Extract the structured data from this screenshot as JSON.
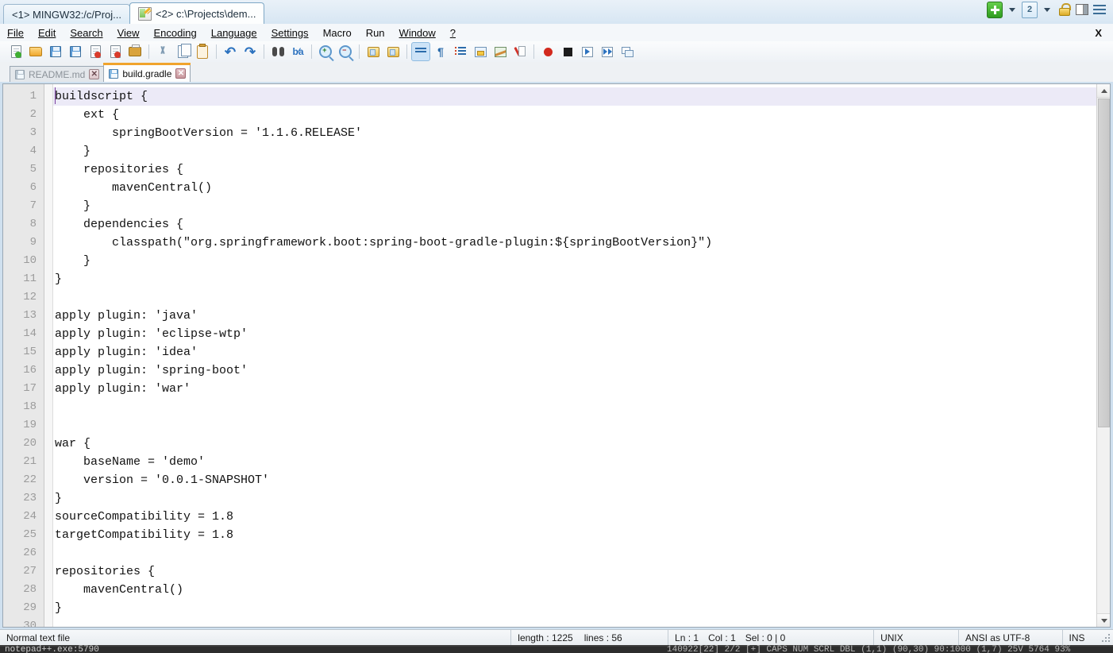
{
  "window": {
    "tabs": [
      {
        "label": "<1> MINGW32:/c/Proj...",
        "active": false,
        "icon": "terminal-icon"
      },
      {
        "label": "<2> c:\\Projects\\dem...",
        "active": true,
        "icon": "notepad-icon"
      }
    ],
    "controls": {
      "new_tab": "+",
      "new_tab_caret": "▾",
      "console_count": "2",
      "console_caret": "▾",
      "lock": "lock-icon",
      "panel": "panel-icon",
      "menu": "hamburger-icon"
    }
  },
  "menubar": {
    "items": [
      "File",
      "Edit",
      "Search",
      "View",
      "Encoding",
      "Language",
      "Settings",
      "Macro",
      "Run",
      "Window",
      "?"
    ],
    "close_label": "X"
  },
  "toolbar": {
    "buttons": [
      {
        "name": "new-file",
        "title": "New"
      },
      {
        "name": "open-file",
        "title": "Open"
      },
      {
        "name": "save-file",
        "title": "Save"
      },
      {
        "name": "save-all",
        "title": "Save All"
      },
      {
        "name": "close-file",
        "title": "Close"
      },
      {
        "name": "close-all",
        "title": "Close All"
      },
      {
        "name": "print",
        "title": "Print"
      },
      {
        "name": "cut",
        "title": "Cut"
      },
      {
        "name": "copy",
        "title": "Copy"
      },
      {
        "name": "paste",
        "title": "Paste"
      },
      {
        "name": "undo",
        "title": "Undo"
      },
      {
        "name": "redo",
        "title": "Redo"
      },
      {
        "name": "find",
        "title": "Find"
      },
      {
        "name": "replace",
        "title": "Replace"
      },
      {
        "name": "zoom-in",
        "title": "Zoom In"
      },
      {
        "name": "zoom-out",
        "title": "Zoom Out"
      },
      {
        "name": "sync-v-scroll",
        "title": "Synchronize Vertical Scrolling"
      },
      {
        "name": "sync-h-scroll",
        "title": "Synchronize Horizontal Scrolling"
      },
      {
        "name": "word-wrap",
        "title": "Word Wrap",
        "active": true
      },
      {
        "name": "show-all-chars",
        "title": "Show All Characters"
      },
      {
        "name": "show-indent-guide",
        "title": "Show Indent Guide"
      },
      {
        "name": "user-define-dialog",
        "title": "User Defined Dialogue"
      },
      {
        "name": "doc-map",
        "title": "Document Map"
      },
      {
        "name": "function-list",
        "title": "Function List"
      },
      {
        "name": "record-macro",
        "title": "Start Recording"
      },
      {
        "name": "stop-macro",
        "title": "Stop Recording"
      },
      {
        "name": "play-macro",
        "title": "Playback"
      },
      {
        "name": "run-multi-macro",
        "title": "Run a Macro Multiple Times"
      },
      {
        "name": "save-macro",
        "title": "Save Current Recorded Macro"
      }
    ]
  },
  "file_tabs": [
    {
      "label": "README.md",
      "active": false,
      "close": "✕"
    },
    {
      "label": "build.gradle",
      "active": true,
      "close": "✕"
    }
  ],
  "editor": {
    "lines": [
      {
        "n": "1",
        "text": "buildscript {",
        "current": true
      },
      {
        "n": "2",
        "text": "    ext {"
      },
      {
        "n": "3",
        "text": "        springBootVersion = '1.1.6.RELEASE'"
      },
      {
        "n": "4",
        "text": "    }"
      },
      {
        "n": "5",
        "text": "    repositories {"
      },
      {
        "n": "6",
        "text": "        mavenCentral()"
      },
      {
        "n": "7",
        "text": "    }"
      },
      {
        "n": "8",
        "text": "    dependencies {"
      },
      {
        "n": "9",
        "text": "        classpath(\"org.springframework.boot:spring-boot-gradle-plugin:${springBootVersion}\")"
      },
      {
        "n": "10",
        "text": "    }"
      },
      {
        "n": "11",
        "text": "}"
      },
      {
        "n": "12",
        "text": ""
      },
      {
        "n": "13",
        "text": "apply plugin: 'java'"
      },
      {
        "n": "14",
        "text": "apply plugin: 'eclipse-wtp'"
      },
      {
        "n": "15",
        "text": "apply plugin: 'idea'"
      },
      {
        "n": "16",
        "text": "apply plugin: 'spring-boot'"
      },
      {
        "n": "17",
        "text": "apply plugin: 'war'"
      },
      {
        "n": "18",
        "text": ""
      },
      {
        "n": "19",
        "text": ""
      },
      {
        "n": "20",
        "text": "war {"
      },
      {
        "n": "21",
        "text": "    baseName = 'demo'"
      },
      {
        "n": "22",
        "text": "    version = '0.0.1-SNAPSHOT'"
      },
      {
        "n": "23",
        "text": "}"
      },
      {
        "n": "24",
        "text": "sourceCompatibility = 1.8"
      },
      {
        "n": "25",
        "text": "targetCompatibility = 1.8"
      },
      {
        "n": "26",
        "text": ""
      },
      {
        "n": "27",
        "text": "repositories {"
      },
      {
        "n": "28",
        "text": "    mavenCentral()"
      },
      {
        "n": "29",
        "text": "}"
      },
      {
        "n": "30",
        "text": ""
      }
    ]
  },
  "statusbar": {
    "filetype": "Normal text file",
    "length": "length : 1225",
    "lines": "lines : 56",
    "ln": "Ln : 1",
    "col": "Col : 1",
    "sel": "Sel : 0 | 0",
    "eol": "UNIX",
    "encoding": "ANSI as UTF-8",
    "mode": "INS"
  },
  "terminal_strip": {
    "left": "notepad++.exe:5790",
    "right": "140922[22]  2/2  [+] CAPS NUM SCRL  DBL   (1,1) (90,30)  90:1000   (1,7) 25V   5764  93%"
  },
  "colors": {
    "accent_orange": "#f0a32c",
    "current_line": "#eceaf7",
    "caret": "#7a3f9e",
    "gutter": "#e8e8e8",
    "chrome": "#cfe0ef"
  }
}
